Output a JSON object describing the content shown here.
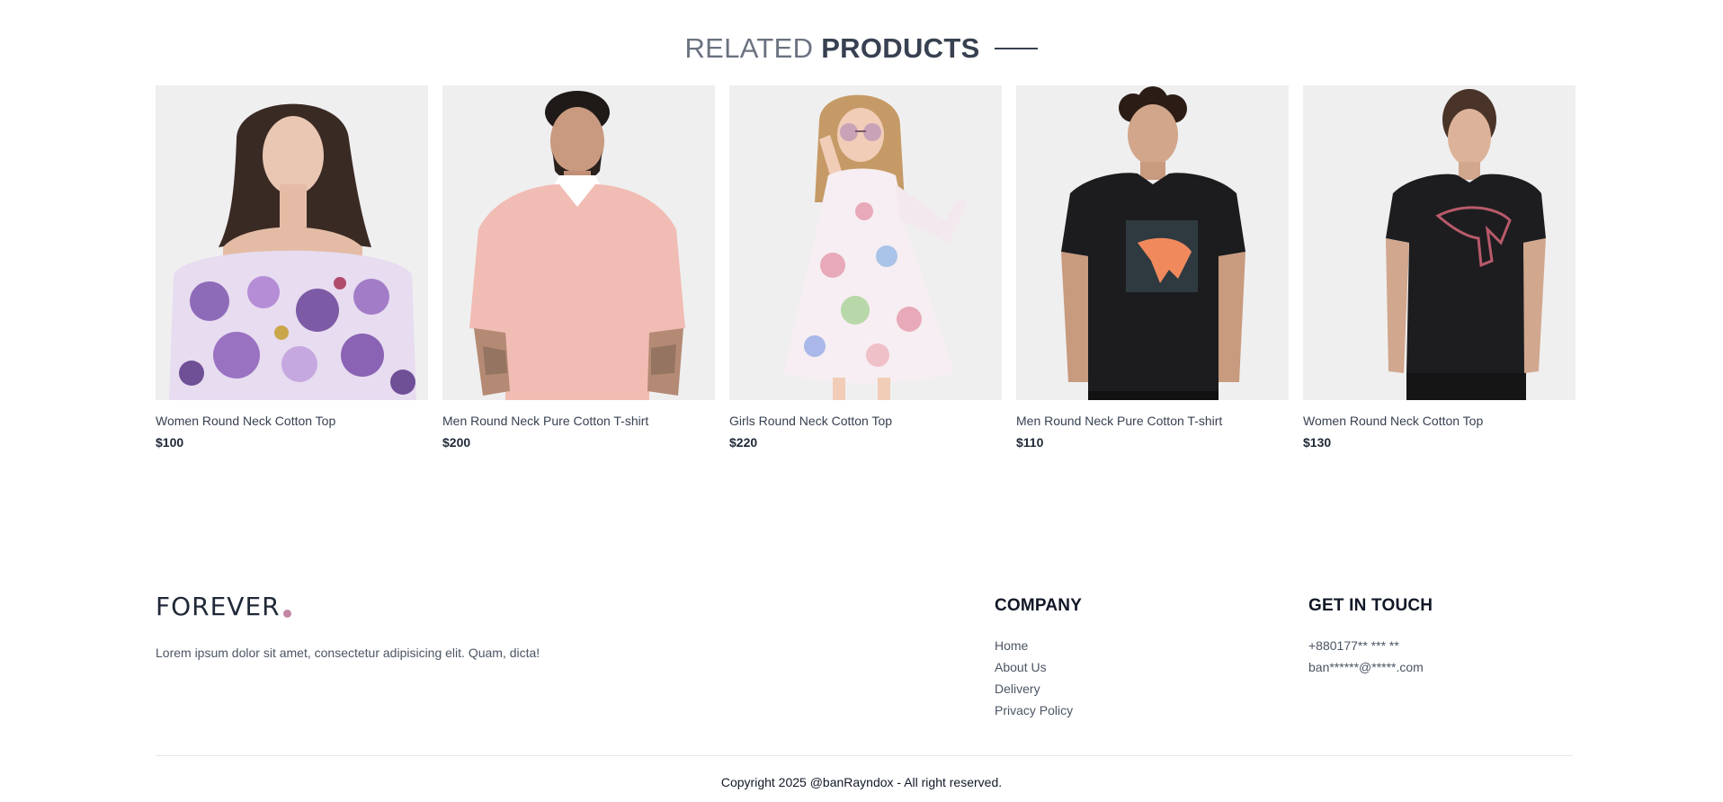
{
  "related": {
    "title_light": "RELATED",
    "title_bold": "PRODUCTS",
    "products": [
      {
        "name": "Women Round Neck Cotton Top",
        "price": "$100"
      },
      {
        "name": "Men Round Neck Pure Cotton T-shirt",
        "price": "$200"
      },
      {
        "name": "Girls Round Neck Cotton Top",
        "price": "$220"
      },
      {
        "name": "Men Round Neck Pure Cotton T-shirt",
        "price": "$110"
      },
      {
        "name": "Women Round Neck Cotton Top",
        "price": "$130"
      }
    ]
  },
  "footer": {
    "logo_text": "FOREVER",
    "logo_accent": "#c586a5",
    "description": "Lorem ipsum dolor sit amet, consectetur adipisicing elit. Quam, dicta!",
    "company": {
      "title": "COMPANY",
      "links": [
        "Home",
        "About Us",
        "Delivery",
        "Privacy Policy"
      ]
    },
    "contact": {
      "title": "GET IN TOUCH",
      "phone": "+880177** *** **",
      "email": "ban******@*****.com"
    },
    "copyright": "Copyright 2025 @banRayndox - All right reserved."
  }
}
